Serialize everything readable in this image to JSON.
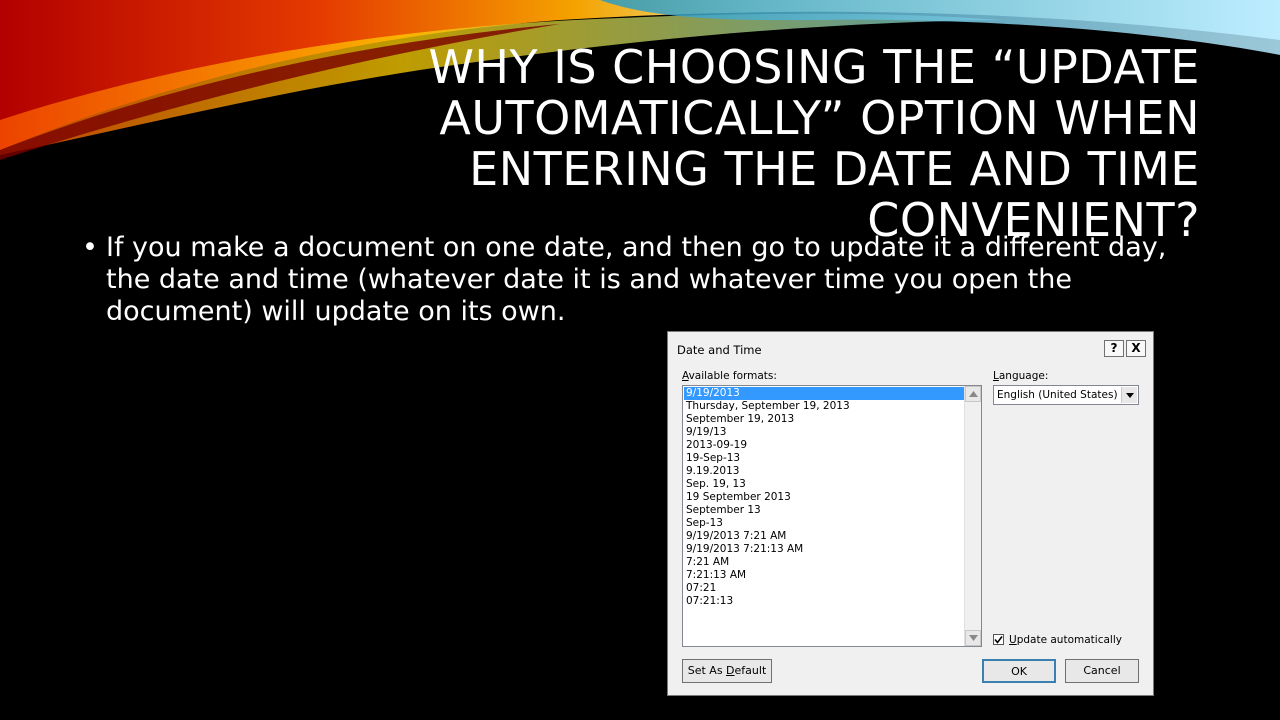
{
  "slide": {
    "title": "Why is choosing the “update automatically” option when entering the date and time convenient?",
    "bullet": "If you make a document on one date, and then go to update it a different day, the date and time (whatever date it is and whatever time you open the document) will update on its own."
  },
  "dialog": {
    "title": "Date and Time",
    "help_label": "?",
    "close_label": "X",
    "formats_label_access": "A",
    "formats_label_rest": "vailable formats:",
    "language_label_access": "L",
    "language_label_rest": "anguage:",
    "formats": [
      "9/19/2013",
      "Thursday, September 19, 2013",
      "September 19, 2013",
      "9/19/13",
      "2013-09-19",
      "19-Sep-13",
      "9.19.2013",
      "Sep. 19, 13",
      "19 September 2013",
      "September 13",
      "Sep-13",
      "9/19/2013 7:21 AM",
      "9/19/2013 7:21:13 AM",
      "7:21 AM",
      "7:21:13 AM",
      "07:21",
      "07:21:13"
    ],
    "selected_format_index": 0,
    "language_value": "English (United States)",
    "update_checkbox": {
      "checked": true,
      "label_access": "U",
      "label_rest": "pdate automatically"
    },
    "buttons": {
      "set_default_pre": "Set As ",
      "set_default_access": "D",
      "set_default_post": "efault",
      "ok": "OK",
      "cancel": "Cancel"
    }
  },
  "colors": {
    "background": "#000000",
    "text": "#ffffff",
    "selection": "#3399ff",
    "dialog_bg": "#f0f0f0"
  }
}
